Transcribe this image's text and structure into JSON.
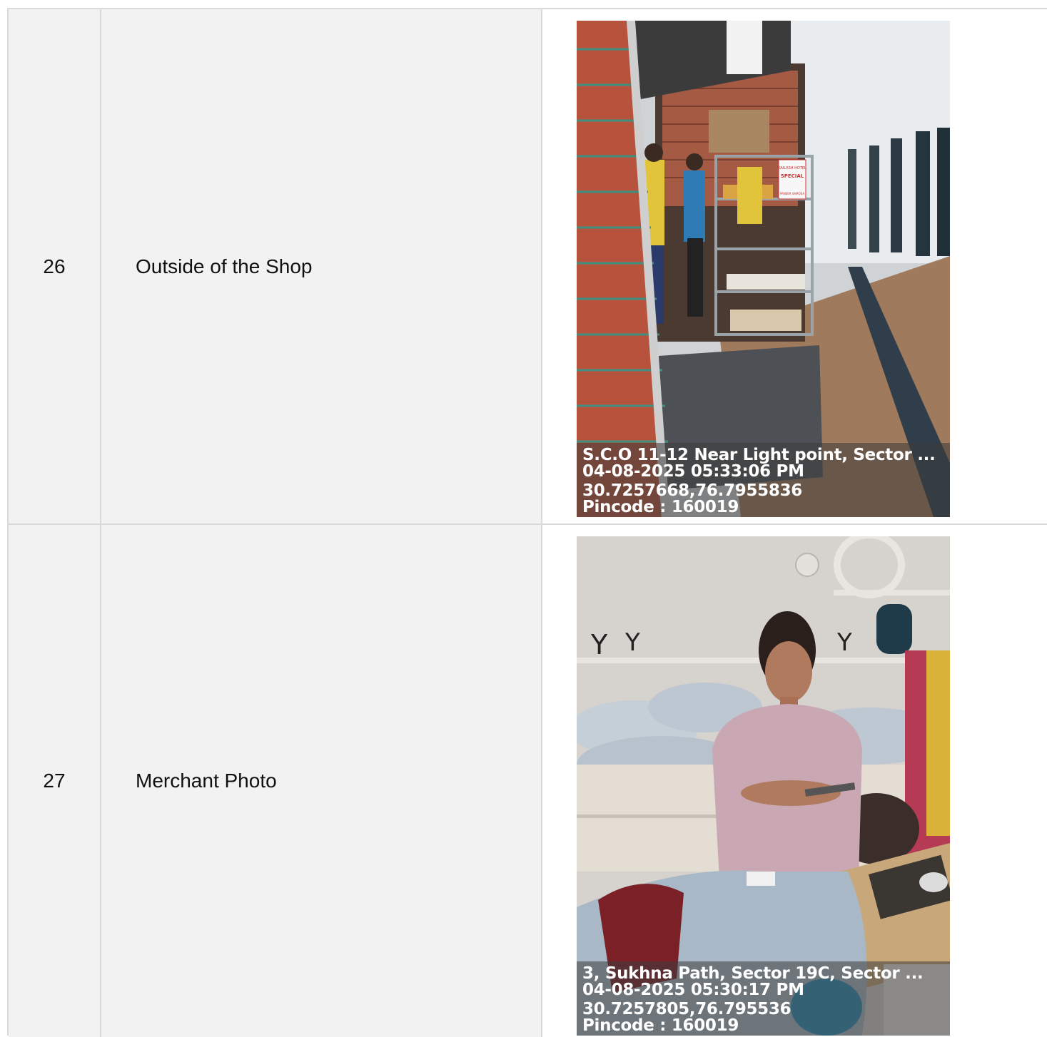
{
  "rows": [
    {
      "number": "26",
      "label": "Outside of the Shop",
      "photo": {
        "subject": "shop-exterior",
        "sign_text_1": "KAILASH HOTEL",
        "sign_text_2": "SPECIAL",
        "sign_text_3": "PANEER SAMOSA",
        "overlay": {
          "address": "S.C.O 11-12 Near Light point, Sector ...",
          "datetime": "04-08-2025 05:33:06 PM",
          "coordinates": "30.7257668,76.7955836",
          "pincode": "Pincode : 160019"
        }
      }
    },
    {
      "number": "27",
      "label": "Merchant Photo",
      "photo": {
        "subject": "merchant-at-counter",
        "overlay": {
          "address": "3, Sukhna Path, Sector 19C, Sector ...",
          "datetime": "04-08-2025 05:30:17 PM",
          "coordinates": "30.7257805,76.795536",
          "pincode": "Pincode : 160019"
        }
      }
    }
  ],
  "colors": {
    "cell_background": "#f2f2f2",
    "border": "#d9d9d9",
    "text": "#111111",
    "overlay_text": "#ffffff"
  }
}
